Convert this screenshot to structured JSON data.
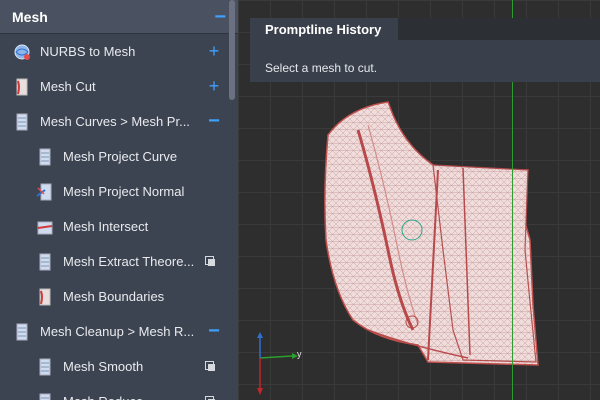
{
  "panel": {
    "title": "Mesh",
    "items": [
      {
        "label": "NURBS to Mesh",
        "level": 0,
        "action": "plus",
        "icon": "nurbs-to-mesh-icon"
      },
      {
        "label": "Mesh Cut",
        "level": 0,
        "action": "plus",
        "icon": "mesh-cut-icon"
      },
      {
        "label": "Mesh Curves > Mesh Pr...",
        "level": 0,
        "action": "minus",
        "icon": "mesh-curves-icon"
      },
      {
        "label": "Mesh Project Curve",
        "level": 1,
        "action": "",
        "icon": "mesh-project-curve-icon"
      },
      {
        "label": "Mesh Project Normal",
        "level": 1,
        "action": "",
        "icon": "mesh-project-normal-icon"
      },
      {
        "label": "Mesh Intersect",
        "level": 1,
        "action": "",
        "icon": "mesh-intersect-icon"
      },
      {
        "label": "Mesh Extract Theore...",
        "level": 1,
        "action": "copy",
        "icon": "mesh-extract-icon"
      },
      {
        "label": "Mesh Boundaries",
        "level": 1,
        "action": "",
        "icon": "mesh-boundaries-icon"
      },
      {
        "label": "Mesh Cleanup > Mesh R...",
        "level": 0,
        "action": "minus",
        "icon": "mesh-cleanup-icon"
      },
      {
        "label": "Mesh Smooth",
        "level": 1,
        "action": "copy",
        "icon": "mesh-smooth-icon"
      },
      {
        "label": "Mesh Reduce",
        "level": 1,
        "action": "copy",
        "icon": "mesh-reduce-icon"
      }
    ]
  },
  "promptline": {
    "tab_label": "Promptline History",
    "message": "Select a mesh to cut."
  },
  "viewport": {
    "axis_y_label": "y",
    "colors": {
      "x_axis": "#c0262b",
      "y_axis": "#2ca02c",
      "z_axis": "#2f6fd0",
      "mesh_edge": "#c0504d"
    }
  }
}
